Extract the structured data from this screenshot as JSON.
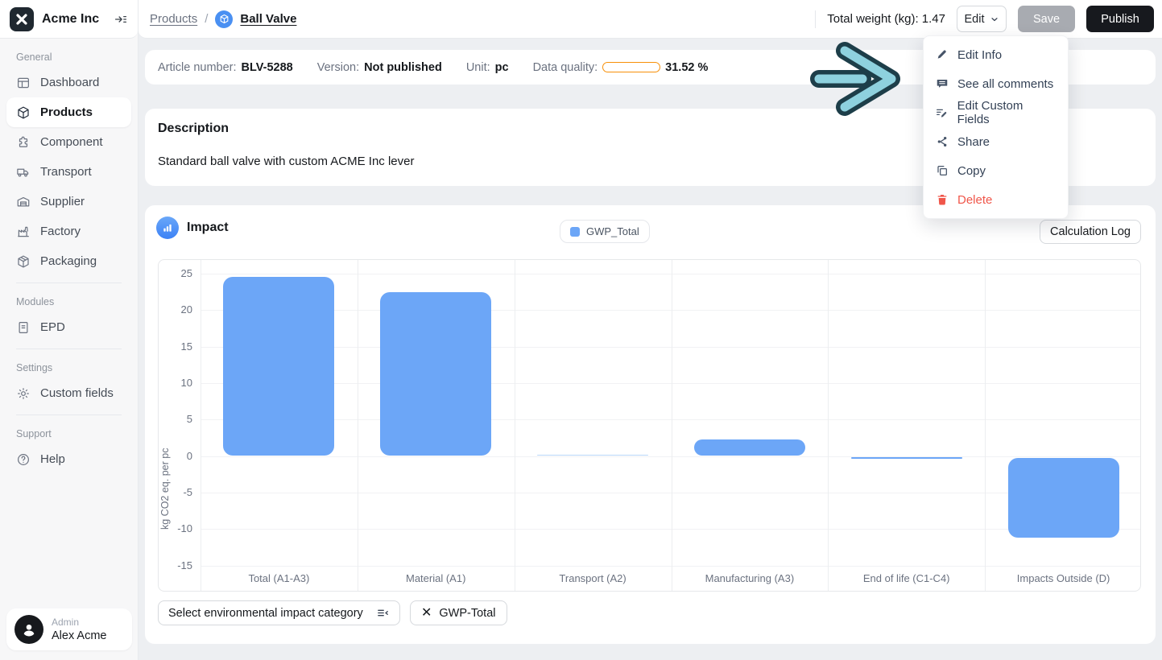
{
  "brand": {
    "name": "Acme Inc"
  },
  "topbar": {
    "breadcrumb": {
      "root": "Products",
      "separator": "/",
      "current": "Ball Valve"
    },
    "total_weight": "Total weight (kg): 1.47",
    "edit_label": "Edit",
    "save_label": "Save",
    "publish_label": "Publish"
  },
  "edit_menu": {
    "items": [
      {
        "label": "Edit Info",
        "icon": "pencil-icon"
      },
      {
        "label": "See all comments",
        "icon": "comment-icon"
      },
      {
        "label": "Edit Custom Fields",
        "icon": "list-pencil-icon"
      },
      {
        "label": "Share",
        "icon": "share-icon"
      },
      {
        "label": "Copy",
        "icon": "copy-icon"
      },
      {
        "label": "Delete",
        "icon": "trash-icon",
        "danger": true
      }
    ]
  },
  "sidebar": {
    "sections": [
      {
        "title": "General",
        "items": [
          {
            "label": "Dashboard",
            "icon": "dashboard-icon"
          },
          {
            "label": "Products",
            "icon": "cube-icon",
            "active": true
          },
          {
            "label": "Component",
            "icon": "puzzle-icon"
          },
          {
            "label": "Transport",
            "icon": "truck-icon"
          },
          {
            "label": "Supplier",
            "icon": "warehouse-icon"
          },
          {
            "label": "Factory",
            "icon": "factory-icon"
          },
          {
            "label": "Packaging",
            "icon": "package-icon"
          }
        ]
      },
      {
        "title": "Modules",
        "items": [
          {
            "label": "EPD",
            "icon": "document-icon"
          }
        ]
      },
      {
        "title": "Settings",
        "items": [
          {
            "label": "Custom fields",
            "icon": "gear-icon"
          }
        ]
      },
      {
        "title": "Support",
        "items": [
          {
            "label": "Help",
            "icon": "help-icon"
          }
        ]
      }
    ],
    "profile": {
      "role": "Admin",
      "name": "Alex Acme"
    }
  },
  "info_bar": {
    "fields": [
      {
        "label": "Article number:",
        "value": "BLV-5288"
      },
      {
        "label": "Version:",
        "value": "Not published"
      },
      {
        "label": "Unit:",
        "value": "pc"
      }
    ],
    "data_quality": {
      "label": "Data quality:",
      "percent": 31.52,
      "percent_label": "31.52 %",
      "bar_color": "#f79009"
    }
  },
  "description_card": {
    "title": "Description",
    "body": "Standard ball valve with custom ACME Inc lever"
  },
  "impact_card": {
    "title": "Impact",
    "legend_label": "GWP_Total",
    "calc_log_label": "Calculation Log",
    "select_placeholder": "Select environmental impact category",
    "chip_label": "GWP-Total"
  },
  "chart_data": {
    "type": "bar",
    "title": "Impact",
    "series": [
      {
        "name": "GWP_Total",
        "values": [
          24.6,
          22.5,
          0.03,
          2.3,
          -0.15,
          -11.2
        ]
      }
    ],
    "categories": [
      "Total (A1-A3)",
      "Material (A1)",
      "Transport (A2)",
      "Manufacturing (A3)",
      "End of life (C1-C4)",
      "Impacts Outside (D)"
    ],
    "ylabel": "kg CO2 eq. per pc",
    "ylim": [
      -15,
      25
    ],
    "yticks": [
      25,
      20,
      15,
      10,
      5,
      0,
      -5,
      -10,
      -15
    ],
    "grid": true,
    "legend_position": "top-center",
    "bar_color": "#6CA6F7"
  },
  "colors": {
    "accent_blue": "#6CA6F7",
    "orange": "#f79009",
    "danger_red": "#f0564a",
    "arrow_fill": "#8ed1de",
    "arrow_stroke": "#1d3e49"
  }
}
